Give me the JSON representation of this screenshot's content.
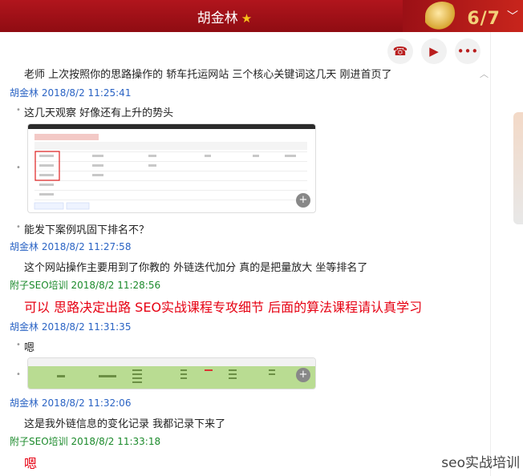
{
  "window": {
    "title": "胡金林",
    "banner_text": "6/7"
  },
  "toolbar": {
    "call_icon": "phone-icon",
    "video_icon": "video-icon",
    "more_icon": "more-icon"
  },
  "messages": [
    {
      "type": "text",
      "text": "老师  上次按照你的思路操作的 轿车托运网站 三个核心关键词这几天 刚进首页了"
    },
    {
      "type": "sender",
      "name": "胡金林",
      "time": "2018/8/2 11:25:41"
    },
    {
      "type": "text",
      "text": "这几天观察 好像还有上升的势头"
    },
    {
      "type": "image",
      "desc": "keyword ranking screenshot"
    },
    {
      "type": "text",
      "text": "能发下案例巩固下排名不？"
    },
    {
      "type": "sender",
      "name": "胡金林",
      "time": "2018/8/2 11:27:58"
    },
    {
      "type": "text",
      "text": "这个网站操作主要用到了你教的 外链迭代加分 真的是把量放大 坐等排名了"
    },
    {
      "type": "sender",
      "name": "附子SEO培训",
      "time": "2018/8/2 11:28:56"
    },
    {
      "type": "text",
      "text": "可以  思路决定出路  SEO实战课程专攻细节  后面的算法课程请认真学习"
    },
    {
      "type": "sender",
      "name": "胡金林",
      "time": "2018/8/2 11:31:35"
    },
    {
      "type": "text",
      "text": "嗯"
    },
    {
      "type": "image",
      "desc": "backlink record screenshot"
    },
    {
      "type": "sender",
      "name": "胡金林",
      "time": "2018/8/2 11:32:06"
    },
    {
      "type": "text",
      "text": "这是我外链信息的变化记录  我都记录下来了"
    },
    {
      "type": "sender",
      "name": "附子SEO培训",
      "time": "2018/8/2 11:33:18"
    },
    {
      "type": "text",
      "text": "嗯"
    }
  ],
  "watermark": "seo实战培训",
  "colors": {
    "accent": "#a3141b",
    "sender_student": "#2a63c4",
    "sender_teacher": "#1b8a2b",
    "teacher_text": "#e60012"
  }
}
